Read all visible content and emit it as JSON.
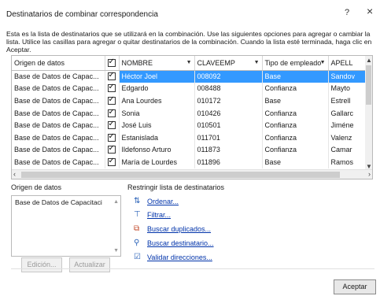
{
  "dialog": {
    "title": "Destinatarios de combinar correspondencia",
    "help": "?",
    "close": "×",
    "description": "Esta es la lista de destinatarios que se utilizará en la combinación. Use las siguientes opciones para agregar o cambiar la lista. Utilice las casillas para agregar o quitar destinatarios de la combinación. Cuando la lista esté terminada, haga clic en Aceptar."
  },
  "grid": {
    "headers": {
      "source": "Origen de datos",
      "name": "NOMBRE",
      "key": "CLAVEEMP",
      "type": "Tipo de empleado",
      "last": "APELL"
    },
    "rows": [
      {
        "source": "Base de Datos de Capac...",
        "name": "Héctor Joel",
        "key": "008092",
        "type": "Base",
        "last": "Sandov"
      },
      {
        "source": "Base de Datos de Capac...",
        "name": "Edgardo",
        "key": "008488",
        "type": "Confianza",
        "last": "Mayto"
      },
      {
        "source": "Base de Datos de Capac...",
        "name": "Ana Lourdes",
        "key": "010172",
        "type": "Base",
        "last": "Estrell"
      },
      {
        "source": "Base de Datos de Capac...",
        "name": "Sonia",
        "key": "010426",
        "type": "Confianza",
        "last": "Gallarc"
      },
      {
        "source": "Base de Datos de Capac...",
        "name": "José Luis",
        "key": "010501",
        "type": "Confianza",
        "last": "Jiméne"
      },
      {
        "source": "Base de Datos de Capac...",
        "name": "Estanislada",
        "key": "011701",
        "type": "Confianza",
        "last": "Valenz"
      },
      {
        "source": "Base de Datos de Capac...",
        "name": "Ildefonso Arturo",
        "key": "011873",
        "type": "Confianza",
        "last": "Camar"
      },
      {
        "source": "Base de Datos de Capac...",
        "name": "María de Lourdes",
        "key": "011896",
        "type": "Base",
        "last": "Ramos"
      }
    ]
  },
  "source_panel": {
    "label": "Origen de datos",
    "item": "Base de Datos de Capacitaci",
    "edit": "Edición...",
    "update": "Actualizar"
  },
  "refine": {
    "label": "Restringir lista de destinatarios",
    "sort": "Ordenar...",
    "filter": "Filtrar...",
    "duplicates": "Buscar duplicados...",
    "find": "Buscar destinatario...",
    "validate": "Validar direcciones..."
  },
  "footer": {
    "ok": "Aceptar"
  }
}
